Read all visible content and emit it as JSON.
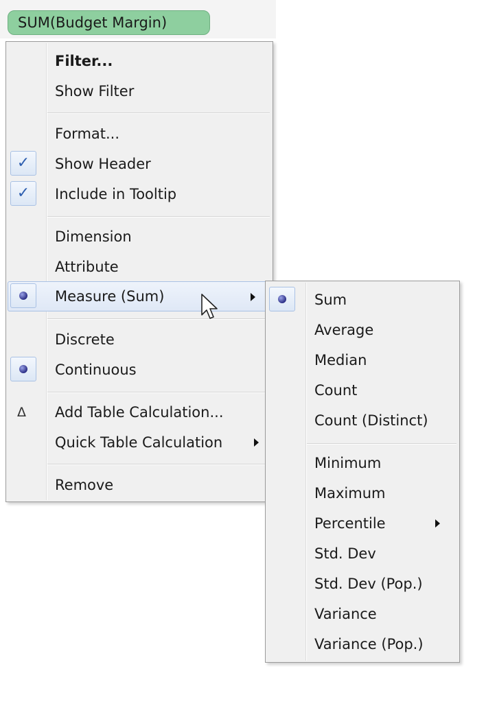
{
  "pill": {
    "label": "SUM(Budget Margin)"
  },
  "context_menu": {
    "filter": "Filter...",
    "show_filter": "Show Filter",
    "format": "Format...",
    "show_header": "Show Header",
    "include_in_tooltip": "Include in Tooltip",
    "dimension": "Dimension",
    "attribute": "Attribute",
    "measure": "Measure (Sum)",
    "discrete": "Discrete",
    "continuous": "Continuous",
    "add_table_calculation": "Add Table Calculation...",
    "quick_table_calculation": "Quick Table Calculation",
    "remove": "Remove",
    "checked_items": [
      "Show Header",
      "Include in Tooltip"
    ],
    "selected_items": [
      "Measure (Sum)",
      "Continuous"
    ]
  },
  "measure_submenu": {
    "sum": "Sum",
    "average": "Average",
    "median": "Median",
    "count": "Count",
    "count_distinct": "Count (Distinct)",
    "minimum": "Minimum",
    "maximum": "Maximum",
    "percentile": "Percentile",
    "std_dev": "Std. Dev",
    "std_dev_pop": "Std. Dev (Pop.)",
    "variance": "Variance",
    "variance_pop": "Variance (Pop.)",
    "selected": "Sum"
  },
  "icons": {
    "check": "checkmark-icon",
    "radio": "radio-dot-icon",
    "delta": "delta-icon",
    "submenu": "submenu-arrow-icon",
    "cursor": "mouse-pointer-icon"
  },
  "colors": {
    "pill_fill": "#8ecf9f",
    "menu_background": "#f0f0f0",
    "hover_border": "#a9c1e4",
    "check_color": "#2e5fb0",
    "radio_color": "#2c2f86"
  }
}
